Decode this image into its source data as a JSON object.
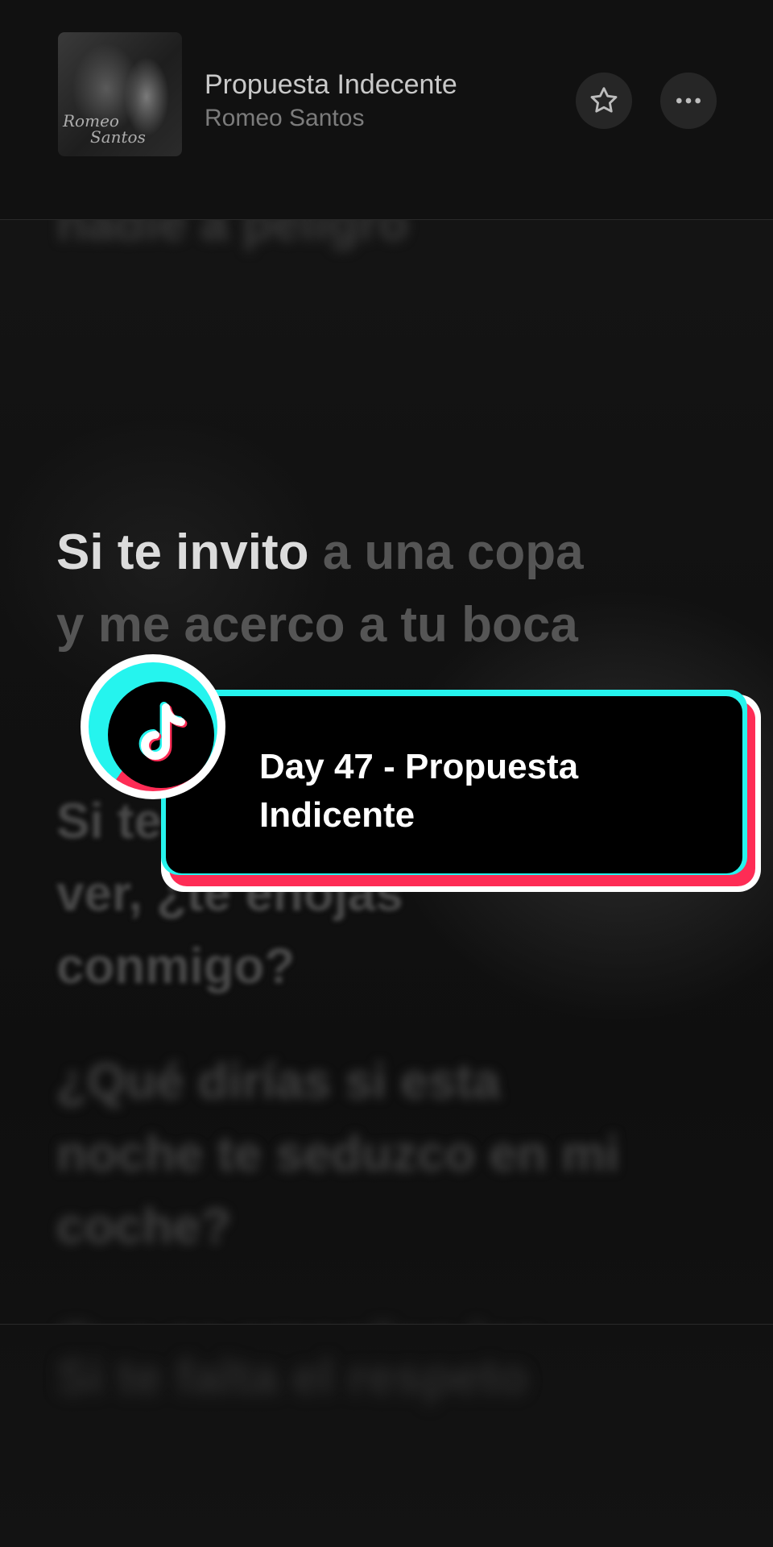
{
  "now_playing": {
    "title": "Propuesta Indecente",
    "artist": "Romeo Santos",
    "album_art_text": [
      "Romeo",
      "Santos"
    ]
  },
  "actions": {
    "favorite_icon": "star-icon",
    "more_icon": "more-horizontal-icon"
  },
  "lyrics": {
    "previous": "nadie a peligro",
    "current": {
      "sung": "Si te invito",
      "unsung": " a una copa y me acerco a tu boca"
    },
    "upcoming": [
      "Si te robo un besito, a ver, ¿te enojas conmigo?",
      "¿Qué dirías si esta noche te seduzco en mi coche?",
      "Que se empañen los vidrios y la regla es que goces",
      "Si te falta el respeto"
    ]
  },
  "sticker": {
    "icon": "tiktok-logo-icon",
    "text": "Day 47 - Propuesta Indicente",
    "colors": {
      "cyan": "#25f4ee",
      "red": "#fe2c55",
      "fill": "#000000",
      "outline": "#ffffff"
    }
  }
}
